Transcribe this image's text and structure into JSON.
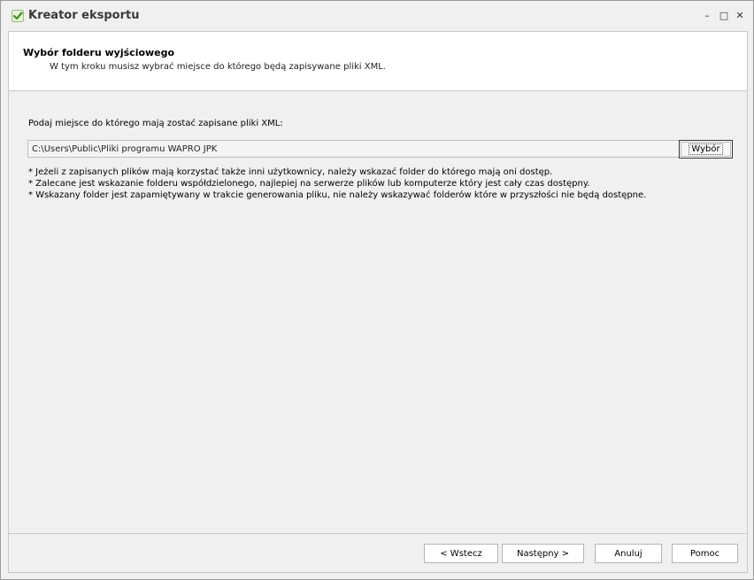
{
  "window": {
    "title": "Kreator eksportu",
    "controls": {
      "minimize": "–",
      "maximize": "□",
      "close": "✕"
    },
    "icon": "green-check-icon"
  },
  "header": {
    "title": "Wybór folderu wyjściowego",
    "description": "W tym kroku musisz wybrać miejsce do którego będą zapisywane pliki XML."
  },
  "main": {
    "prompt": "Podaj miejsce do którego mają zostać zapisane pliki XML:",
    "path_value": "C:\\Users\\Public\\Pliki programu WAPRO JPK",
    "browse_label": "Wybór",
    "notes": [
      "* Jeżeli z zapisanych plików mają korzystać także inni użytkownicy, należy wskazać folder do którego mają oni dostęp.",
      "* Zalecane jest wskazanie folderu współdzielonego, najlepiej na serwerze plików lub komputerze który jest cały czas dostępny.",
      "* Wskazany folder jest zapamiętywany w trakcie generowania pliku, nie należy wskazywać folderów które w przyszłości nie będą dostępne."
    ]
  },
  "footer": {
    "back_label": "< Wstecz",
    "next_label": "Następny >",
    "cancel_label": "Anuluj",
    "help_label": "Pomoc"
  },
  "colors": {
    "accent_check": "#5aa02c",
    "window_bg": "#f0f0f0",
    "header_bg": "#ffffff"
  }
}
